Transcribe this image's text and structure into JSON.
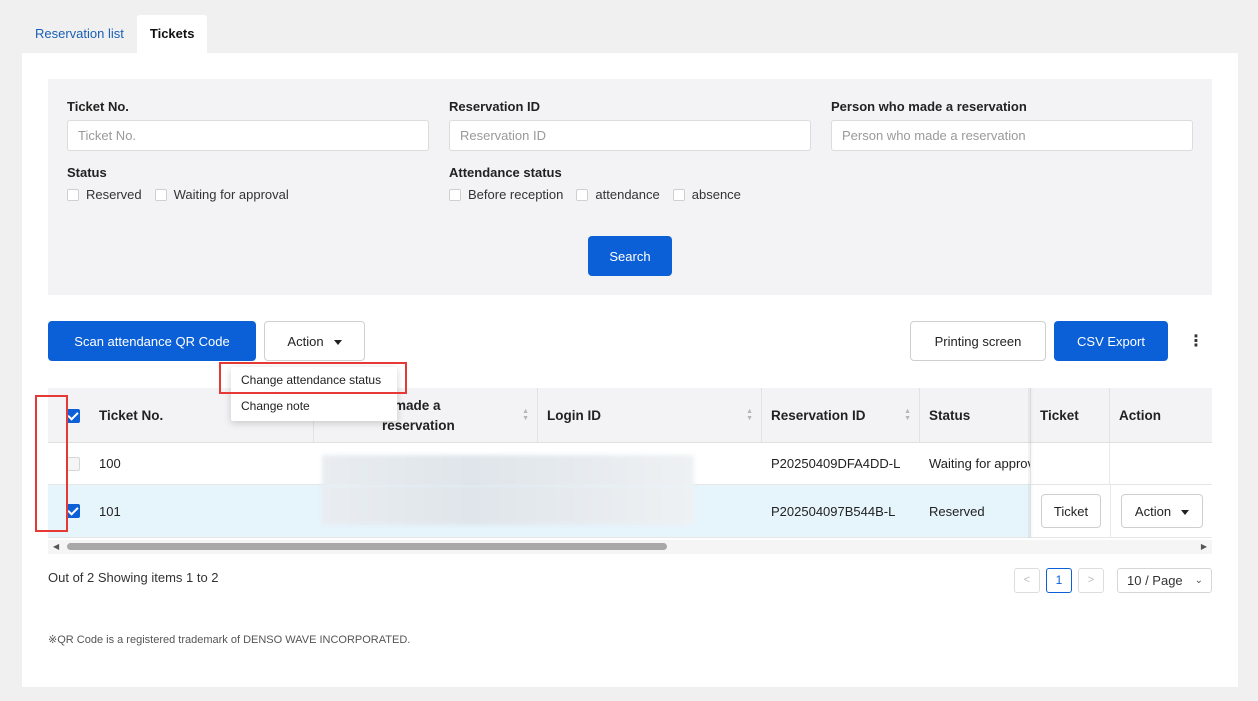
{
  "tabs": [
    {
      "label": "Reservation list",
      "active": false
    },
    {
      "label": "Tickets",
      "active": true
    }
  ],
  "filters": {
    "ticket_no": {
      "label": "Ticket No.",
      "placeholder": "Ticket No.",
      "value": ""
    },
    "reservation_id": {
      "label": "Reservation ID",
      "placeholder": "Reservation ID",
      "value": ""
    },
    "person": {
      "label": "Person who made a reservation",
      "placeholder": "Person who made a reservation",
      "value": ""
    },
    "status": {
      "label": "Status",
      "options": [
        "Reserved",
        "Waiting for approval"
      ]
    },
    "attendance": {
      "label": "Attendance status",
      "options": [
        "Before reception",
        "attendance",
        "absence"
      ]
    },
    "search_label": "Search"
  },
  "toolbar": {
    "scan_label": "Scan attendance QR Code",
    "action_label": "Action",
    "print_label": "Printing screen",
    "csv_label": "CSV Export",
    "more": "⋮"
  },
  "action_menu": {
    "items": [
      "Change attendance status",
      "Change note"
    ]
  },
  "table": {
    "columns": {
      "ticket_no": "Ticket No.",
      "person": "o made a reservation",
      "login_id": "Login ID",
      "reservation_id": "Reservation ID",
      "status": "Status",
      "ticket": "Ticket",
      "action": "Action"
    },
    "rows": [
      {
        "checked": false,
        "ticket_no": "100",
        "reservation_id": "P20250409DFA4DD-L",
        "status": "Waiting for approval",
        "ticket_button": "",
        "action_button": ""
      },
      {
        "checked": true,
        "ticket_no": "101",
        "reservation_id": "P202504097B544B-L",
        "status": "Reserved",
        "ticket_button": "Ticket",
        "action_button": "Action"
      }
    ],
    "select_all_checked": true
  },
  "pagination": {
    "summary": "Out of 2 Showing items 1 to 2",
    "prev": "<",
    "current_page": "1",
    "next": ">",
    "page_size": "10 / Page"
  },
  "footnote": "※QR Code is a registered trademark of DENSO WAVE INCORPORATED.",
  "colors": {
    "primary": "#0b5fd7",
    "highlight": "#e53935",
    "selected_row": "#e6f4fc"
  }
}
